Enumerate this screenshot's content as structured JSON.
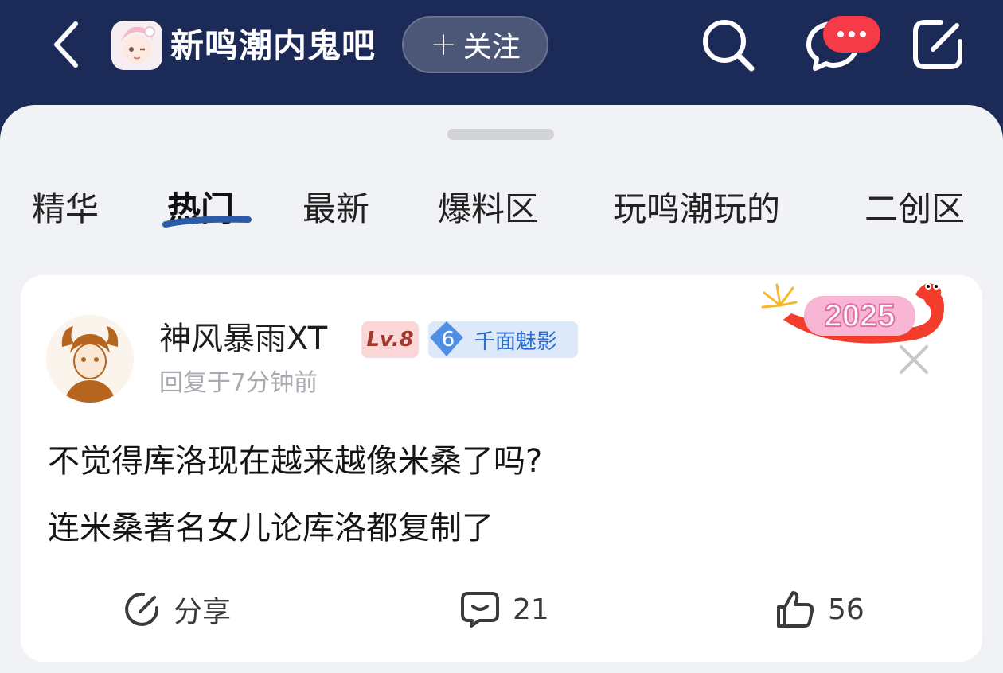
{
  "header": {
    "forum_name": "新鸣潮内鬼吧",
    "follow_label": "关注",
    "follow_plus": "+"
  },
  "tabs": [
    {
      "label": "精华"
    },
    {
      "label": "热门"
    },
    {
      "label": "最新"
    },
    {
      "label": "爆料区"
    },
    {
      "label": "玩鸣潮玩的"
    },
    {
      "label": "二创区"
    }
  ],
  "post": {
    "username": "神风暴雨XT",
    "level_badge": "Lv.8",
    "title_badge_num": "6",
    "title_badge_text": "千面魅影",
    "reply_time": "回复于7分钟前",
    "decoration_text": "2025",
    "line1": "不觉得库洛现在越来越像米桑了吗?",
    "line2": "连米桑著名女儿论库洛都复制了",
    "actions": {
      "share_label": "分享",
      "comment_count": "21",
      "like_count": "56"
    }
  },
  "icons": {
    "back": "chevron-left-icon",
    "search": "search-icon",
    "messages": "chat-bubble-icon",
    "compose": "compose-icon",
    "share": "share-icon",
    "comment": "comment-icon",
    "like": "thumbs-up-icon",
    "close": "close-icon"
  },
  "colors": {
    "header_bg": "#1c2a57",
    "sheet_bg": "#f1f2f6",
    "badge_red": "#f43b47",
    "tab_underline": "#2a5aa8",
    "level_badge_bg": "#fbd8d7",
    "title_badge_bg": "#dde9f8"
  }
}
